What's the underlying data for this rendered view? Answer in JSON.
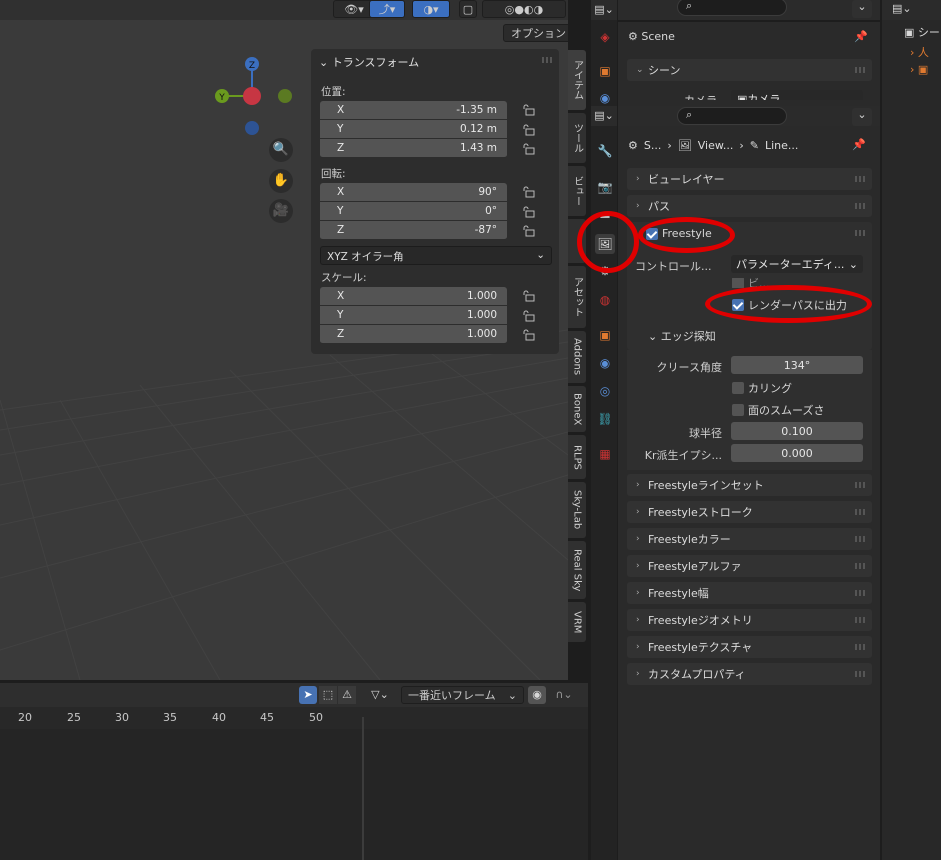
{
  "viewport": {
    "options_label": "オプション",
    "gizmo": {
      "z": "Z",
      "y": "Y"
    },
    "npanel": {
      "title": "トランスフォーム",
      "location_label": "位置:",
      "location": [
        {
          "axis": "X",
          "value": "-1.35 m"
        },
        {
          "axis": "Y",
          "value": "0.12 m"
        },
        {
          "axis": "Z",
          "value": "1.43 m"
        }
      ],
      "rotation_label": "回転:",
      "rotation": [
        {
          "axis": "X",
          "value": "90°"
        },
        {
          "axis": "Y",
          "value": "0°"
        },
        {
          "axis": "Z",
          "value": "-87°"
        }
      ],
      "rotation_mode": "XYZ オイラー角",
      "scale_label": "スケール:",
      "scale": [
        {
          "axis": "X",
          "value": "1.000"
        },
        {
          "axis": "Y",
          "value": "1.000"
        },
        {
          "axis": "Z",
          "value": "1.000"
        }
      ]
    },
    "side_tabs": [
      "アイテム",
      "ツール",
      "ビュー",
      "",
      "アセット",
      "Addons",
      "BoneX",
      "RLPS",
      "Sky-Lab",
      "Real Sky",
      "VRM"
    ]
  },
  "timeline": {
    "snap_label": "一番近いフレーム",
    "frames": [
      "20",
      "25",
      "30",
      "35",
      "40",
      "45",
      "50"
    ]
  },
  "scene_props": {
    "scene_name": "Scene",
    "section": "シーン",
    "camera_label": "カメラ",
    "camera_value": "カメラ"
  },
  "props": {
    "breadcrumb": [
      "S...",
      "View...",
      "Line..."
    ],
    "panels_top": [
      "ビューレイヤー",
      "パス"
    ],
    "freestyle_label": "Freestyle",
    "control_label": "コントロール...",
    "control_value": "パラメーターエディ...",
    "hidden_row": "ビ...",
    "render_pass_label": "レンダーパスに出力",
    "edge_detect": "エッジ探知",
    "crease_label": "クリース角度",
    "crease_value": "134°",
    "culling_label": "カリング",
    "smooth_label": "面のスムーズさ",
    "sphere_label": "球半径",
    "sphere_value": "0.100",
    "kr_label": "Kr派生イプシ...",
    "kr_value": "0.000",
    "panels_bottom": [
      "Freestyleラインセット",
      "Freestyleストローク",
      "Freestyleカラー",
      "Freestyleアルファ",
      "Freestyle幅",
      "Freestyleジオメトリ",
      "Freestyleテクスチャ",
      "カスタムプロパティ"
    ]
  },
  "outliner": {
    "item": "シー"
  },
  "colors": {
    "accent": "#4772b3",
    "highlight": "#e00000",
    "axis_x": "#c73643",
    "axis_y": "#6a9a1e",
    "axis_z": "#3b6fc0"
  }
}
